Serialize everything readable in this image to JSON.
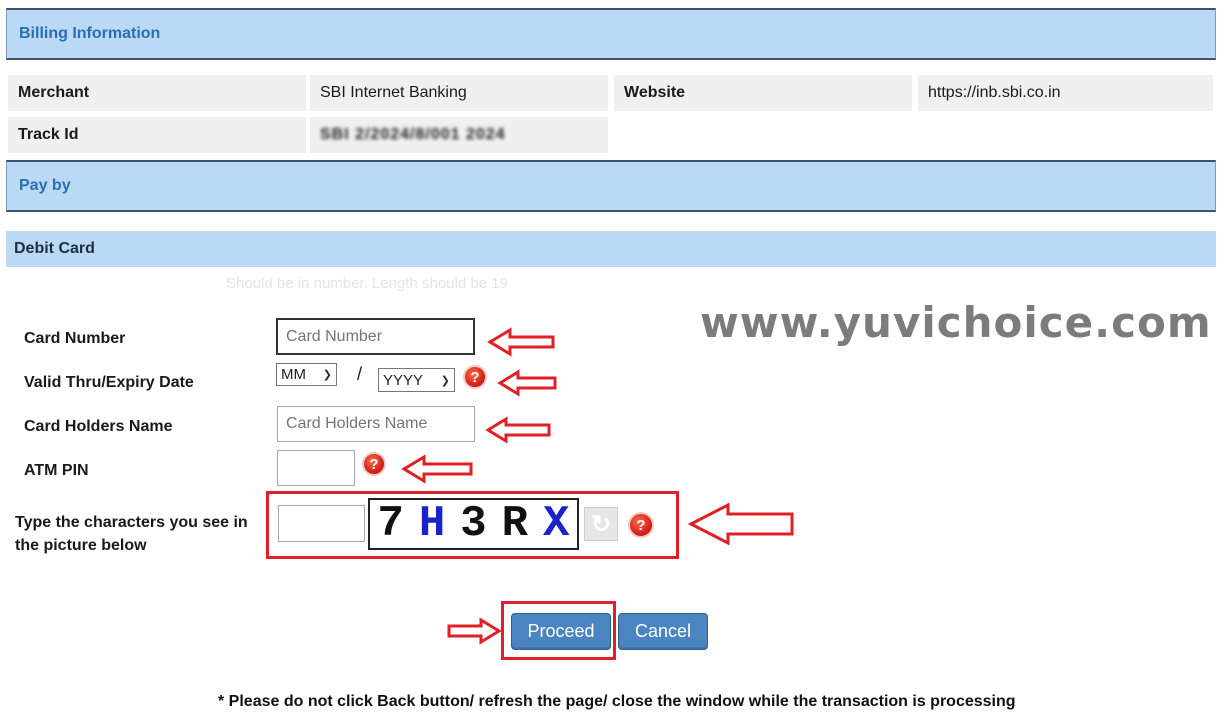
{
  "billing": {
    "header": "Billing Information",
    "merchant_label": "Merchant",
    "merchant_value": "SBI Internet Banking",
    "website_label": "Website",
    "website_value": "https://inb.sbi.co.in",
    "track_label": "Track Id",
    "track_value": "SBI 2/2024/8/001 2024"
  },
  "payby": {
    "header": "Pay by"
  },
  "debit": {
    "header": "Debit Card",
    "hint": "Should be in number. Length should be 19"
  },
  "form": {
    "card_number_label": "Card Number",
    "card_number_placeholder": "Card Number",
    "expiry_label": "Valid Thru/Expiry Date",
    "month_value": "MM",
    "year_value": "YYYY",
    "separator": "/",
    "holder_label": "Card Holders Name",
    "holder_placeholder": "Card Holders Name",
    "pin_label": "ATM PIN",
    "captcha_label": "Type the characters you see in the picture below",
    "captcha_chars": [
      {
        "char": "7",
        "color": "#111111"
      },
      {
        "char": "H",
        "color": "#1a22c8"
      },
      {
        "char": "3",
        "color": "#111111"
      },
      {
        "char": "R",
        "color": "#111111"
      },
      {
        "char": "X",
        "color": "#1a22c8"
      }
    ],
    "help_glyph": "?"
  },
  "actions": {
    "proceed": "Proceed",
    "cancel": "Cancel"
  },
  "footer": "* Please do not click Back button/ refresh the page/ close the window while the transaction is processing",
  "watermark": "www.yuvichoice.com",
  "icons": {
    "help": "question-circle-icon",
    "refresh": "refresh-icon",
    "arrow": "red-outline-arrow-left-icon"
  },
  "colors": {
    "header_bg": "#b9d9f5",
    "header_text": "#2a6fb3",
    "button": "#4a85c2",
    "highlight": "#e01f26"
  }
}
